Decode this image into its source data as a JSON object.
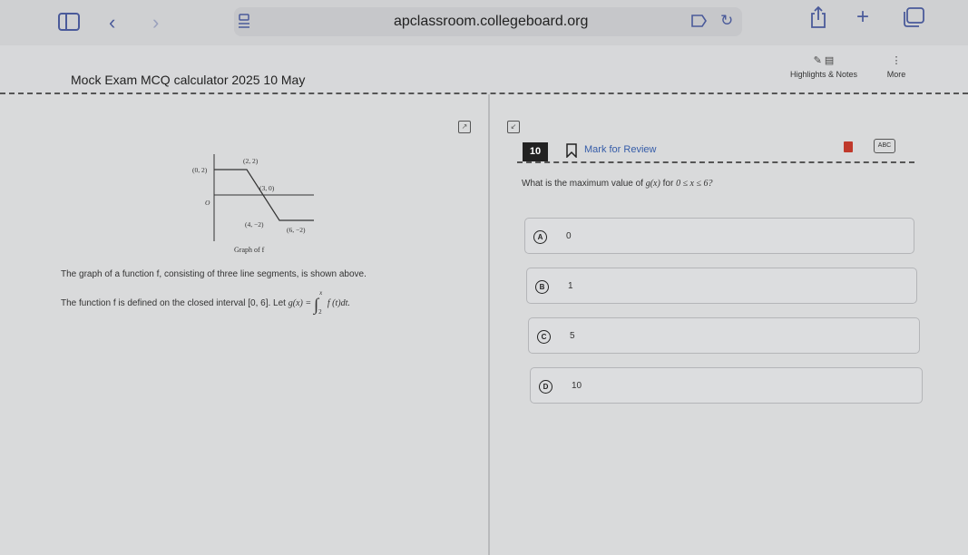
{
  "browser": {
    "url": "apclassroom.collegeboard.org",
    "icons": [
      "sidebar-icon",
      "back-icon",
      "forward-icon",
      "reader-icon",
      "translate-icon",
      "reload-icon",
      "share-icon",
      "new-tab-icon",
      "tabs-icon"
    ]
  },
  "header": {
    "title": "Mock Exam MCQ calculator 2025 10 May",
    "highlights_label": "Highlights & Notes",
    "more_label": "More"
  },
  "figure": {
    "points": {
      "p1": "(0, 2)",
      "p2": "(2, 2)",
      "p3": "(3, 0)",
      "p4": "(4, −2)",
      "p5": "(6, −2)"
    },
    "origin": "O",
    "caption": "Graph of f"
  },
  "stem": {
    "line1": "The graph of a function f, consisting of three line segments, is shown above.",
    "line2_text": "The function f is defined on the closed interval",
    "interval": "[0, 6]",
    "let": ". Let",
    "g_def": "g(x) =",
    "upper": "x",
    "lower": "2",
    "integrand": "f (t)dt."
  },
  "question": {
    "number": "10",
    "mark_for_review": "Mark for Review",
    "abc_label": "ABC",
    "prompt_prefix": "What is the maximum value of",
    "prompt_func": "g(x)",
    "prompt_for": "for",
    "prompt_condition": "0 ≤ x ≤ 6?"
  },
  "choices": [
    {
      "letter": "A",
      "value": "0"
    },
    {
      "letter": "B",
      "value": "1"
    },
    {
      "letter": "C",
      "value": "5"
    },
    {
      "letter": "D",
      "value": "10"
    }
  ],
  "colors": {
    "accent": "#355ca8",
    "number_bg": "#222222",
    "calculator": "#c0392b"
  }
}
